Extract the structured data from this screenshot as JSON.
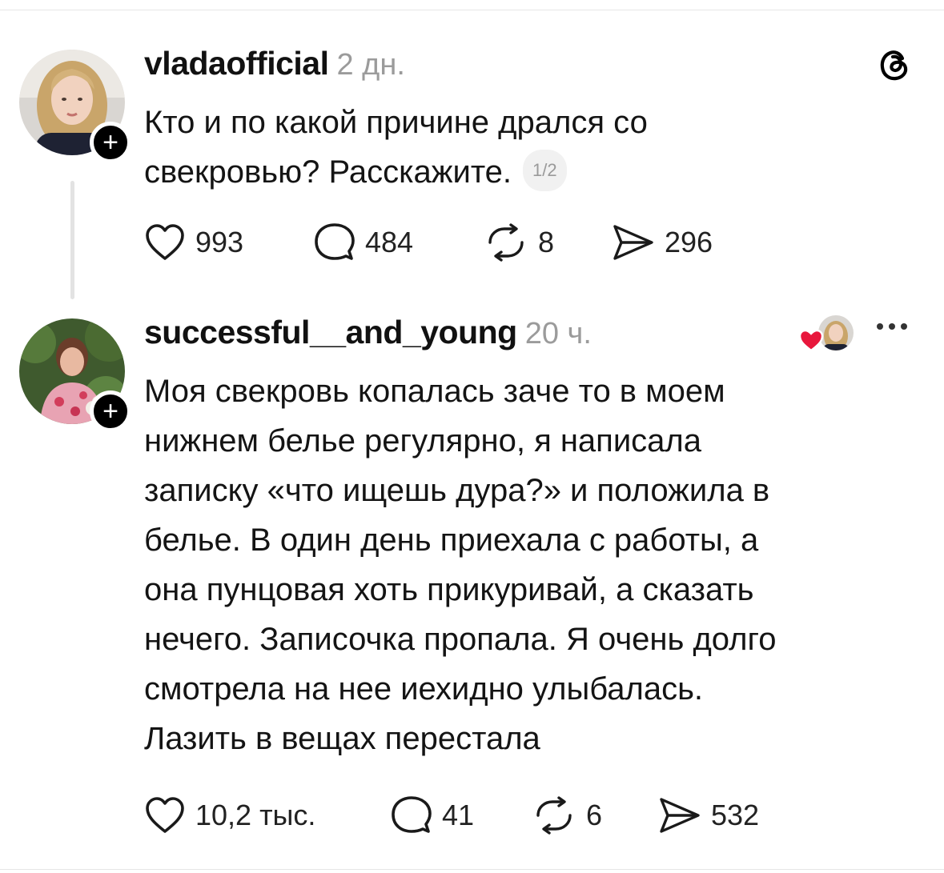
{
  "posts": [
    {
      "username": "vladaofficial",
      "time": "2 дн.",
      "text_lines": [
        "Кто и по какой причине дрался со",
        "свекровью? Расскажите."
      ],
      "page_indicator": "1/2",
      "stats": {
        "likes": "993",
        "replies": "484",
        "reposts": "8",
        "shares": "296"
      }
    },
    {
      "username": "successful__and_young",
      "time": "20 ч.",
      "text_lines": [
        "Моя свекровь копалась заче то в моем",
        "нижнем белье регулярно, я написала",
        "записку «что ищешь дура?» и положила в",
        "белье. В один день приехала с работы, а",
        "она пунцовая хоть прикуривай, а сказать",
        "нечего. Записочка пропала. Я очень долго",
        "смотрела на нее иехидно улыбалась.",
        "Лазить в вещах перестала"
      ],
      "stats": {
        "likes": "10,2 тыс.",
        "replies": "41",
        "reposts": "6",
        "shares": "532"
      }
    }
  ],
  "follow_badge": "+",
  "icons": {
    "app": "threads-logo-icon",
    "like": "heart-icon",
    "reply": "comment-bubble-icon",
    "repost": "repost-icon",
    "share": "send-icon",
    "more": "more-dots-icon"
  },
  "colors": {
    "text": "#141414",
    "muted": "#9b9b9b",
    "liked_heart": "#e8173c"
  }
}
